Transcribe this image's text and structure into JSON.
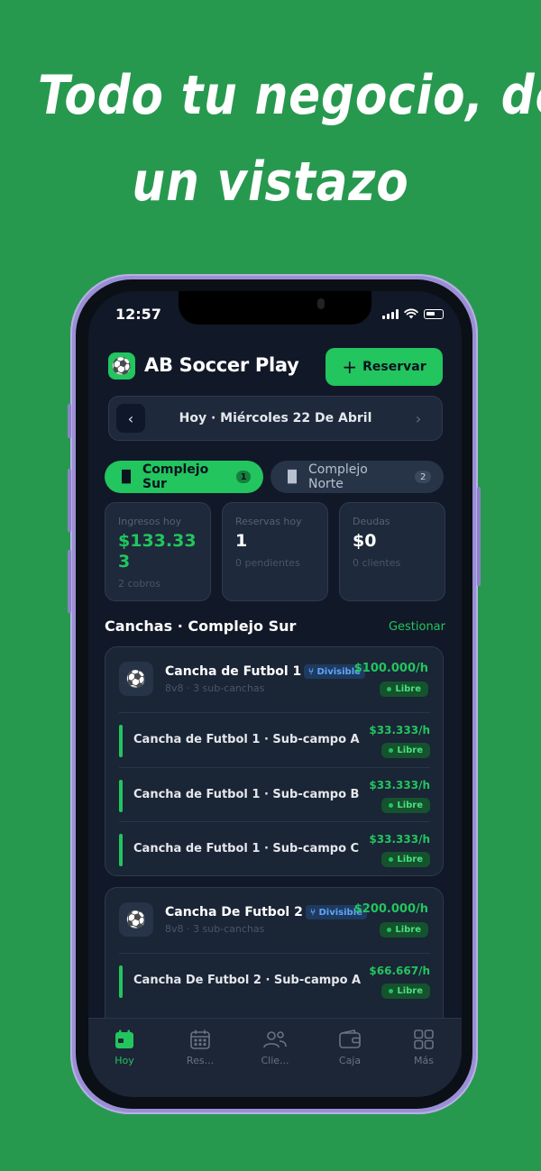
{
  "headline": {
    "line1": "Todo tu negocio, de",
    "line2": "un vistazo"
  },
  "status_bar": {
    "time": "12:57"
  },
  "app": {
    "title": "AB Soccer Play",
    "logo_icon": "soccer-ball-icon",
    "reserve_label": "Reservar",
    "reserve_icon": "+"
  },
  "date_bar": {
    "label": "Hoy · Miércoles 22 De Abril",
    "prev": "‹",
    "next": "›"
  },
  "complex_tabs": [
    {
      "label": "Complejo Sur",
      "count": "1",
      "active": true
    },
    {
      "label": "Complejo Norte",
      "count": "2",
      "active": false
    }
  ],
  "stats": [
    {
      "label": "Ingresos hoy",
      "value": "$133.333",
      "sub": "2 cobros"
    },
    {
      "label": "Reservas hoy",
      "value": "1",
      "sub": "0 pendientes"
    },
    {
      "label": "Deudas",
      "value": "$0",
      "sub": "0 clientes"
    }
  ],
  "section": {
    "title": "Canchas · Complejo Sur",
    "link": "Gestionar"
  },
  "courts": [
    {
      "name": "Cancha de Futbol 1",
      "badge": "Divisible",
      "meta": "8v8 · 3 sub-canchas",
      "price": "$100.000/h",
      "status": "Libre",
      "subs": [
        {
          "name": "Cancha de Futbol 1 · Sub-campo A",
          "price": "$33.333/h",
          "status": "Libre"
        },
        {
          "name": "Cancha de Futbol 1 · Sub-campo B",
          "price": "$33.333/h",
          "status": "Libre"
        },
        {
          "name": "Cancha de Futbol 1 · Sub-campo C",
          "price": "$33.333/h",
          "status": "Libre"
        }
      ]
    },
    {
      "name": "Cancha De Futbol 2",
      "badge": "Divisible",
      "meta": "8v8 · 3 sub-canchas",
      "price": "$200.000/h",
      "status": "Libre",
      "subs": [
        {
          "name": "Cancha De Futbol 2 · Sub-campo A",
          "price": "$66.667/h",
          "status": "Libre"
        }
      ]
    }
  ],
  "bottom_nav": [
    {
      "label": "Hoy",
      "icon": "calendar-today-icon",
      "active": true
    },
    {
      "label": "Res...",
      "icon": "calendar-grid-icon",
      "active": false
    },
    {
      "label": "Clie...",
      "icon": "users-icon",
      "active": false
    },
    {
      "label": "Caja",
      "icon": "wallet-icon",
      "active": false
    },
    {
      "label": "Más",
      "icon": "grid-icon",
      "active": false
    }
  ],
  "colors": {
    "background": "#27994f",
    "accent": "#22c55e",
    "screen_bg": "#111827",
    "card_bg": "#1e293b",
    "frame": "#9a8fd4"
  }
}
